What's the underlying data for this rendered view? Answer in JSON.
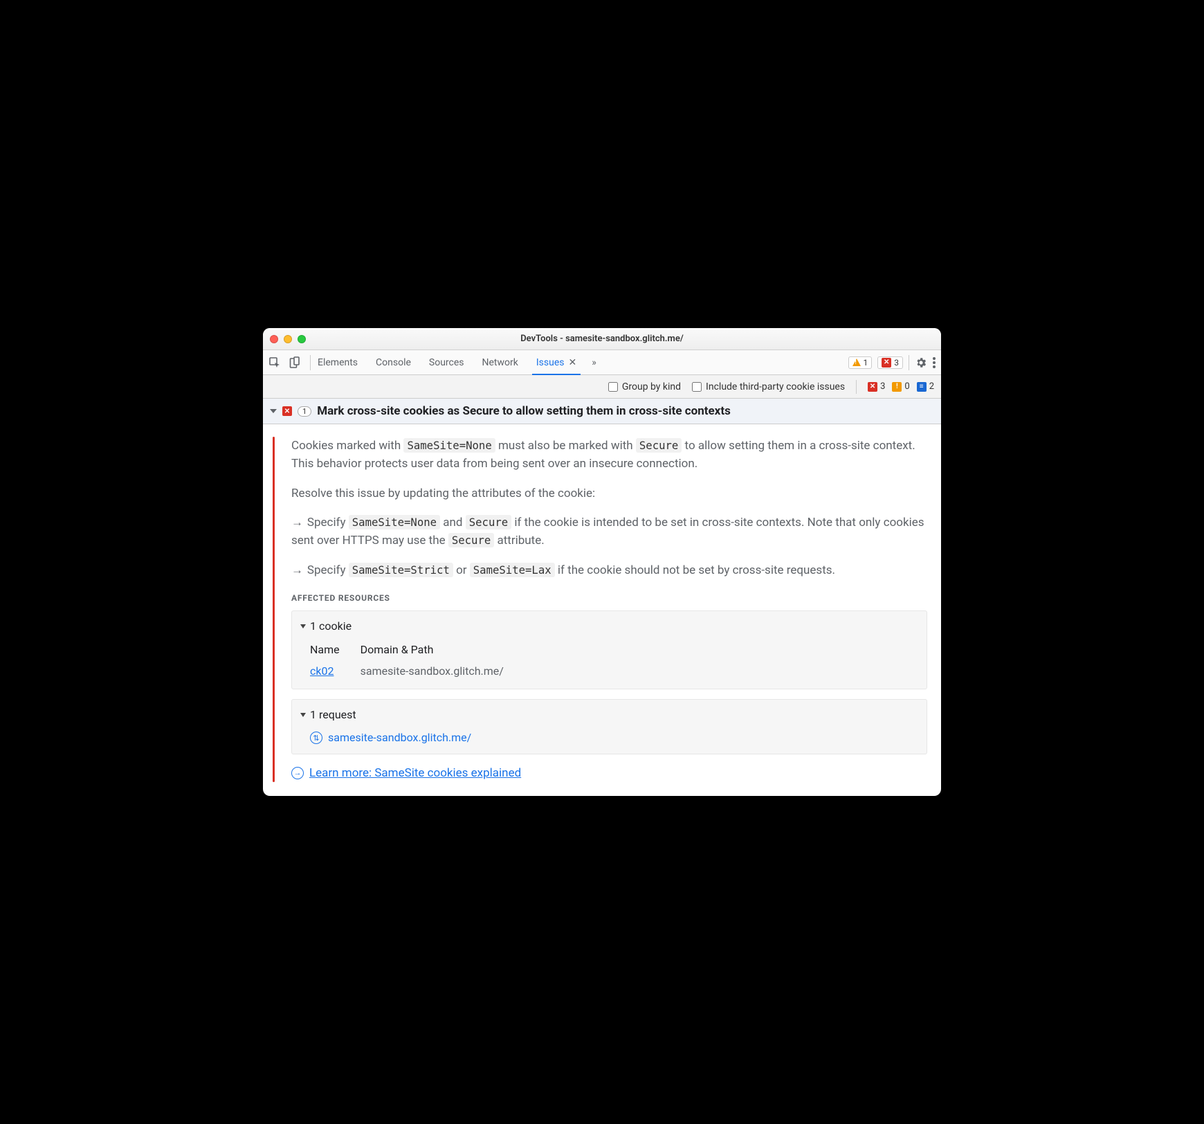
{
  "window_title": "DevTools - samesite-sandbox.glitch.me/",
  "tabs": {
    "elements": "Elements",
    "console": "Console",
    "sources": "Sources",
    "network": "Network",
    "issues": "Issues"
  },
  "topbar_badges": {
    "warn": "1",
    "err": "3"
  },
  "filters": {
    "group_by_kind": "Group by kind",
    "third_party": "Include third-party cookie issues"
  },
  "filter_counts": {
    "err": "3",
    "warn": "0",
    "info": "2"
  },
  "issue": {
    "count": "1",
    "title": "Mark cross-site cookies as Secure to allow setting them in cross-site contexts",
    "p1_a": "Cookies marked with ",
    "p1_code1": "SameSite=None",
    "p1_b": " must also be marked with ",
    "p1_code2": "Secure",
    "p1_c": " to allow setting them in a cross-site context. This behavior protects user data from being sent over an insecure connection.",
    "p2": "Resolve this issue by updating the attributes of the cookie:",
    "b1_a": "Specify ",
    "b1_code1": "SameSite=None",
    "b1_b": " and ",
    "b1_code2": "Secure",
    "b1_c": " if the cookie is intended to be set in cross-site contexts. Note that only cookies sent over HTTPS may use the ",
    "b1_code3": "Secure",
    "b1_d": " attribute.",
    "b2_a": "Specify ",
    "b2_code1": "SameSite=Strict",
    "b2_b": " or ",
    "b2_code2": "SameSite=Lax",
    "b2_c": " if the cookie should not be set by cross-site requests."
  },
  "affected": {
    "label": "Affected Resources",
    "cookies_head": "1 cookie",
    "cookie_col_name": "Name",
    "cookie_col_domain": "Domain & Path",
    "cookie_name": "ck02",
    "cookie_domain": "samesite-sandbox.glitch.me/",
    "requests_head": "1 request",
    "request_url": "samesite-sandbox.glitch.me/"
  },
  "learn_more": "Learn more: SameSite cookies explained"
}
